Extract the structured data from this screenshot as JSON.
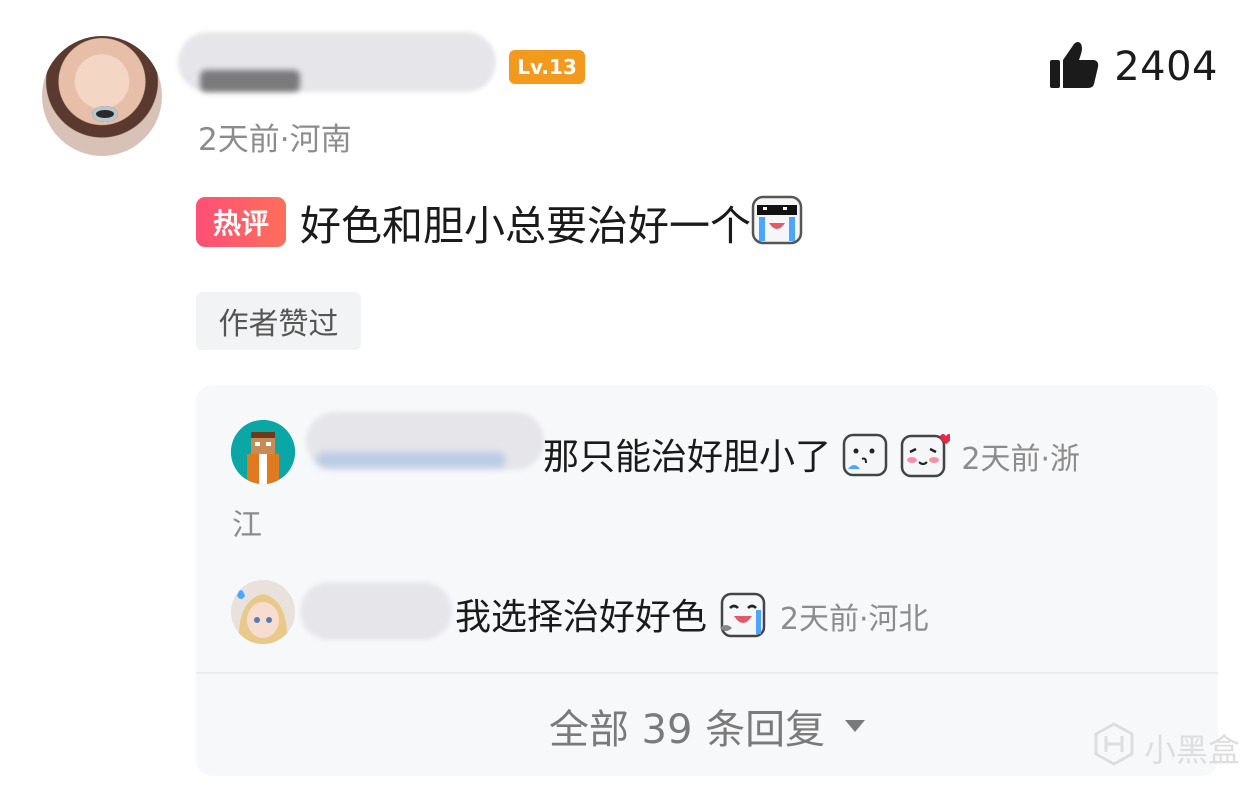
{
  "comment": {
    "level_badge": "Lv.13",
    "like_count": "2404",
    "meta": "2天前·河南",
    "hot_badge": "热评",
    "text": "好色和胆小总要治好一个",
    "author_liked": "作者赞过"
  },
  "replies": [
    {
      "text": "那只能治好胆小了",
      "meta_line1": "2天前·浙",
      "meta_line2": "江"
    },
    {
      "text": "我选择治好好色",
      "meta": "2天前·河北"
    }
  ],
  "footer": {
    "all_replies": "全部 39 条回复"
  },
  "watermark": {
    "text": "小黑盒"
  },
  "colors": {
    "level_badge": "#f39a1e",
    "hot_badge": "#ff4f76",
    "panel_bg": "#f7f8fa",
    "meta_text": "#8c8c8c"
  },
  "icons": [
    "thumbs-up-icon",
    "cool-cry-emoji",
    "nervous-sweat-emoji",
    "blush-heart-emoji",
    "laugh-cry-emoji",
    "chevron-down-icon",
    "heybox-logo-icon"
  ]
}
